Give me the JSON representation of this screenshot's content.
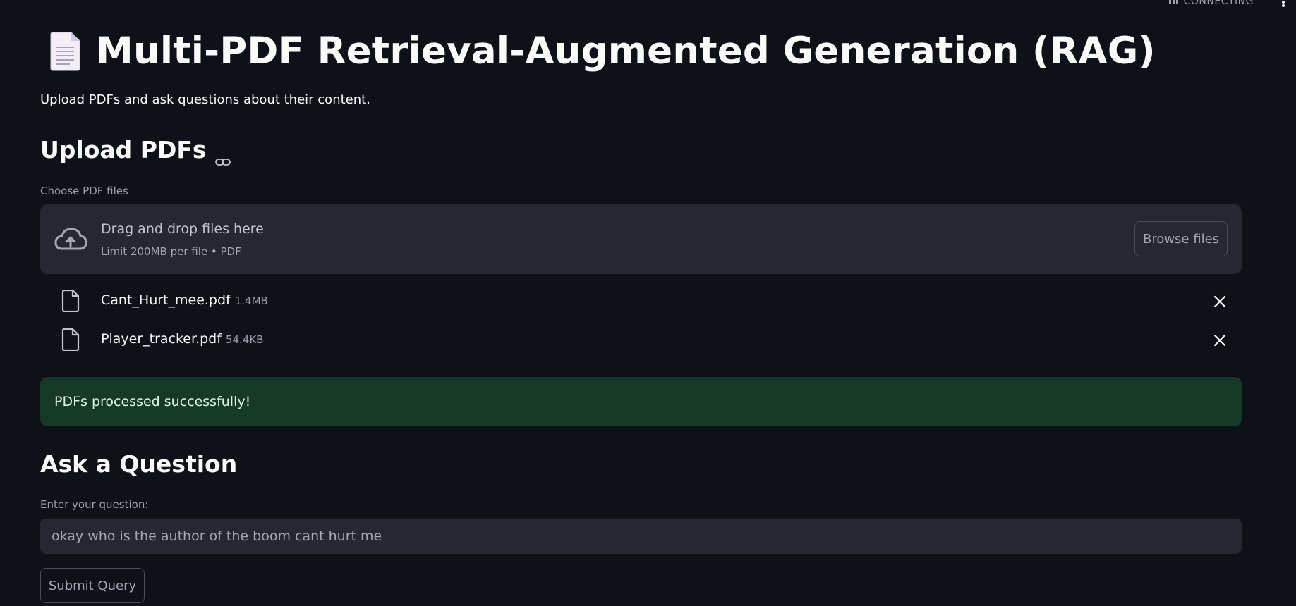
{
  "status": {
    "text": "CONNECTING"
  },
  "header": {
    "title": "Multi-PDF Retrieval-Augmented Generation (RAG)",
    "subtitle": "Upload PDFs and ask questions about their content.",
    "icon": "document-icon"
  },
  "upload": {
    "section_title": "Upload PDFs",
    "field_label": "Choose PDF files",
    "dropzone_text": "Drag and drop files here",
    "dropzone_limit": "Limit 200MB per file • PDF",
    "browse_label": "Browse files",
    "files": [
      {
        "name": "Cant_Hurt_mee.pdf",
        "size": "1.4MB"
      },
      {
        "name": "Player_tracker.pdf",
        "size": "54.4KB"
      }
    ]
  },
  "success": {
    "message": "PDFs processed successfully!"
  },
  "question": {
    "section_title": "Ask a Question",
    "field_label": "Enter your question:",
    "value": "okay who is the author of the boom cant hurt me",
    "submit_label": "Submit Query"
  },
  "colors": {
    "background": "#0e1117",
    "panel": "#262730",
    "success_bg": "#173928",
    "text": "#fafafa",
    "muted": "#9aa0ab"
  }
}
